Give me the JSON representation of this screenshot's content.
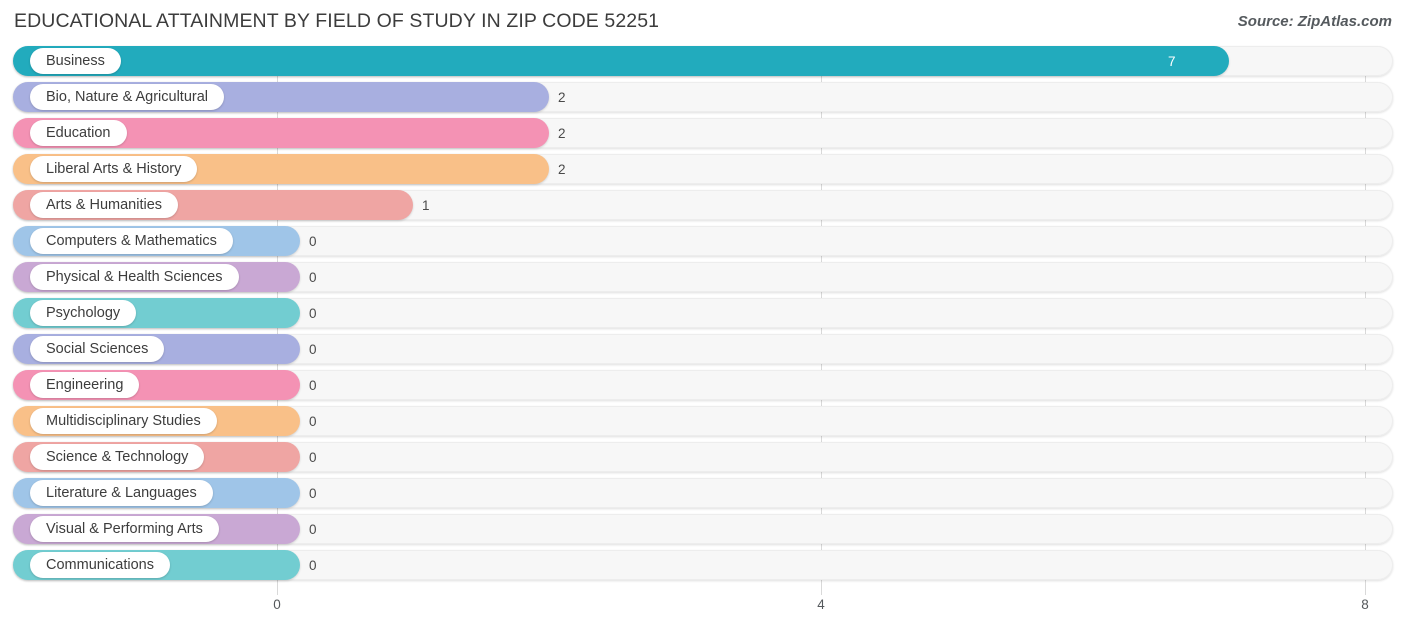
{
  "header": {
    "title": "EDUCATIONAL ATTAINMENT BY FIELD OF STUDY IN ZIP CODE 52251",
    "source": "Source: ZipAtlas.com"
  },
  "axis": {
    "ticks": [
      "0",
      "4",
      "8"
    ]
  },
  "chart_data": {
    "type": "bar",
    "orientation": "horizontal",
    "title": "EDUCATIONAL ATTAINMENT BY FIELD OF STUDY IN ZIP CODE 52251",
    "subtitle": "Source: ZipAtlas.com",
    "xlabel": "",
    "ylabel": "",
    "xlim": [
      0,
      8
    ],
    "xticks": [
      0,
      4,
      8
    ],
    "grid": true,
    "legend": false,
    "categories": [
      "Business",
      "Bio, Nature & Agricultural",
      "Education",
      "Liberal Arts & History",
      "Arts & Humanities",
      "Computers & Mathematics",
      "Physical & Health Sciences",
      "Psychology",
      "Social Sciences",
      "Engineering",
      "Multidisciplinary Studies",
      "Science & Technology",
      "Literature & Languages",
      "Visual & Performing Arts",
      "Communications"
    ],
    "values": [
      7,
      2,
      2,
      2,
      1,
      0,
      0,
      0,
      0,
      0,
      0,
      0,
      0,
      0,
      0
    ],
    "value_labels": [
      "7",
      "2",
      "2",
      "2",
      "1",
      "0",
      "0",
      "0",
      "0",
      "0",
      "0",
      "0",
      "0",
      "0",
      "0"
    ],
    "colors": [
      "#22abbd",
      "#a8afe0",
      "#f492b4",
      "#f9c088",
      "#efa5a3",
      "#9fc5e8",
      "#c9a8d4",
      "#72cdd1",
      "#a8afe0",
      "#f492b4",
      "#f9c088",
      "#efa5a3",
      "#9fc5e8",
      "#c9a8d4",
      "#72cdd1"
    ]
  }
}
